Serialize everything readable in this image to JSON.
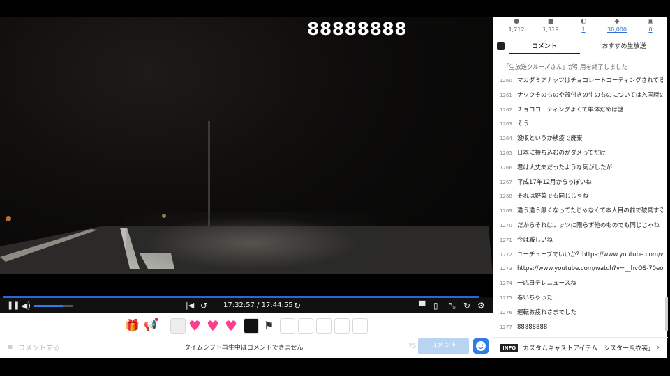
{
  "player": {
    "overlay_comment": "88888888",
    "time": "17:32:57 / 17:44:55",
    "volume": 0.75,
    "progress": 0.98
  },
  "controls": {
    "icons": [
      "pause-icon",
      "volume-icon",
      "skip-start-icon",
      "rewind-10-icon",
      "forward-10-icon",
      "comment-toggle-icon",
      "theater-icon",
      "fullscreen-icon",
      "reload-icon",
      "settings-icon"
    ]
  },
  "stats": [
    {
      "icon": "viewer-icon",
      "glyph": "●",
      "value": "1,712",
      "link": false
    },
    {
      "icon": "comment-count-icon",
      "glyph": "■",
      "value": "1,319",
      "link": false
    },
    {
      "icon": "ad-icon",
      "glyph": "◐",
      "value": "1",
      "link": true
    },
    {
      "icon": "ad-points-icon",
      "glyph": "◆",
      "value": "30,000",
      "link": true
    },
    {
      "icon": "gift-count-icon",
      "glyph": "▣",
      "value": "0",
      "link": true
    }
  ],
  "tabs": {
    "comment": "コメント",
    "recommend": "おすすめ生放送"
  },
  "system_message": "「生放送クルーズさん」が引用を終了しました",
  "comments": [
    {
      "num": "1260",
      "text": "マカダミアナッツはチョコレートコーティングされてるから良"
    },
    {
      "num": "1261",
      "text": "ナッツそのものや殻付きの生のものについては入国時の検査に"
    },
    {
      "num": "1262",
      "text": "チョココーティングよくて単体だめは謎"
    },
    {
      "num": "1263",
      "text": "そう"
    },
    {
      "num": "1264",
      "text": "没収というか検疫で廃棄"
    },
    {
      "num": "1265",
      "text": "日本に持ち込むのがダメってだけ"
    },
    {
      "num": "1266",
      "text": "君は大丈夫だったような気がしたが"
    },
    {
      "num": "1267",
      "text": "平成17年12月からっぽいね"
    },
    {
      "num": "1268",
      "text": "それは野菜でも同じじゃね"
    },
    {
      "num": "1269",
      "text": "違う違う無くなってたじゃなくて本人目の前で破棄するのよ"
    },
    {
      "num": "1270",
      "text": "だからそれはナッツに限らず他のものでも同じじゃね"
    },
    {
      "num": "1271",
      "text": "今は厳しいね"
    },
    {
      "num": "1272",
      "text": "ユーチューブでいいか？https://www.youtube.com/watch"
    },
    {
      "num": "1273",
      "text": "https://www.youtube.com/watch?v=__hvOS-70eo"
    },
    {
      "num": "1274",
      "text": "一応日テレニュースね"
    },
    {
      "num": "1275",
      "text": "春いちゃった"
    },
    {
      "num": "1276",
      "text": "運転お疲れさまでした"
    },
    {
      "num": "1277",
      "text": "88888888"
    }
  ],
  "info": {
    "badge": "INFO",
    "text": "カスタムキャストアイテム「シスター風衣装」を…"
  },
  "input": {
    "placeholder": "コメントする",
    "disabled_message": "タイムシフト再生中はコメントできません",
    "char_count": "75",
    "submit": "コメント"
  },
  "colors": {
    "accent": "#2f7bea",
    "heart": "#ff3c8e"
  }
}
